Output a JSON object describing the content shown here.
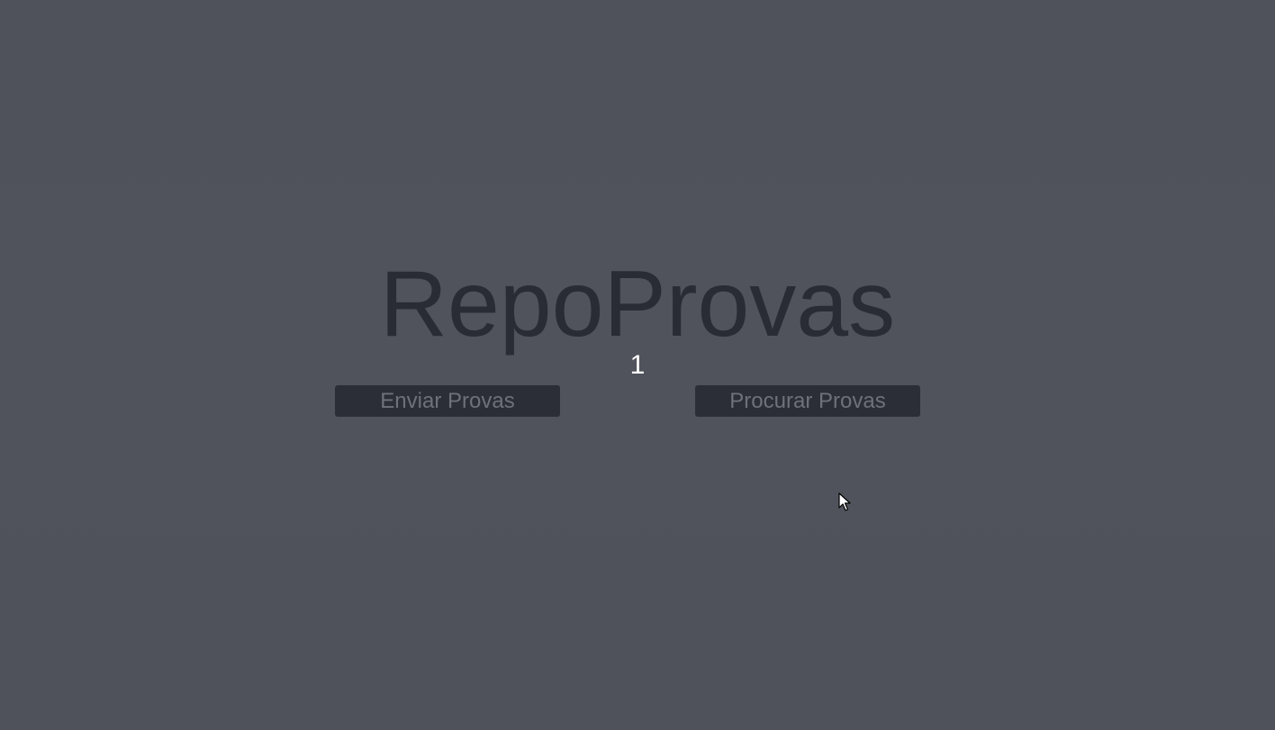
{
  "app": {
    "title": "RepoProvas",
    "counter": "1"
  },
  "actions": {
    "send_label": "Enviar Provas",
    "search_label": "Procurar Provas"
  },
  "colors": {
    "background": "#50535c",
    "title": "#292c35",
    "button_bg": "#2b2e37",
    "button_text": "#6e717a",
    "counter": "#ffffff"
  },
  "icons": {
    "cursor": "mouse-pointer-icon"
  }
}
